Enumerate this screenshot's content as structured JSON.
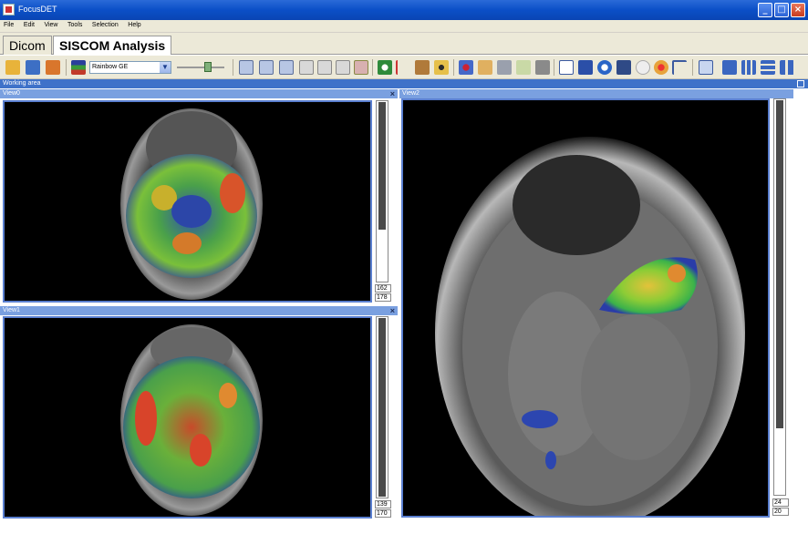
{
  "window": {
    "title": "FocusDET"
  },
  "menu": {
    "items": [
      "File",
      "Edit",
      "View",
      "Tools",
      "Selection",
      "Help"
    ]
  },
  "tabs": [
    {
      "label": "Dicom"
    },
    {
      "label": "SISCOM Analysis"
    }
  ],
  "toolbar": {
    "colormap_value": "Rainbow GE"
  },
  "working_area": {
    "title": "Working area"
  },
  "views": [
    {
      "title": "View0",
      "value_top": "162",
      "value_bottom": "178"
    },
    {
      "title": "View1",
      "value_top": "139",
      "value_bottom": "170"
    },
    {
      "title": "View2",
      "value_top": "24",
      "value_bottom": "20"
    }
  ]
}
